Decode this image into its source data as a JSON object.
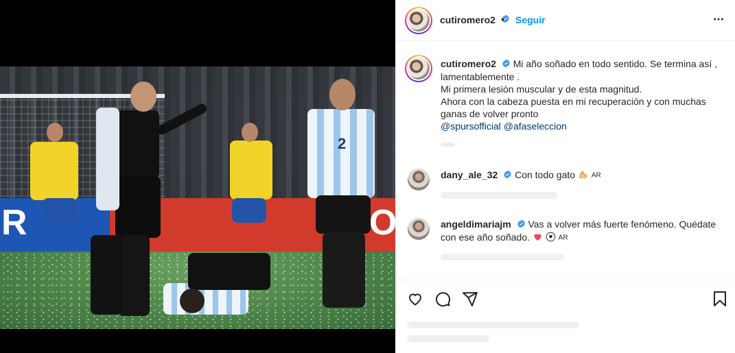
{
  "post": {
    "author": "cutiromero2",
    "verified": true,
    "follow_label": "Seguir",
    "separator": "•"
  },
  "caption": {
    "username": "cutiromero2",
    "lines": [
      "Mi año soñado en todo sentido. Se termina así ,",
      "lamentablemente .",
      "Mi primera lesión muscular y de esta magnitud.",
      "Ahora con la cabeza puesta en mi recuperación y con muchas",
      "ganas de volver pronto"
    ],
    "mentions": [
      "@spursofficial",
      "@afaseleccion"
    ]
  },
  "comments": [
    {
      "username": "dany_ale_32",
      "verified": true,
      "text": "Con todo gato",
      "emojis": [
        "flexed-biceps-icon"
      ],
      "flag_code": "AR"
    },
    {
      "username": "angeldimariajm",
      "verified": true,
      "text_line1": "Vas a volver más fuerte fenómeno. Quédate",
      "text_line2": "con ese año soñado.",
      "emojis": [
        "heart-icon",
        "soccer-ball-icon"
      ],
      "flag_code": "AR"
    }
  ],
  "photo": {
    "board_text_left": "R",
    "board_text_right": "O",
    "jersey_number": "2"
  },
  "icons": {
    "verified": "verified-badge-icon",
    "more": "more-options-icon",
    "like": "heart-icon",
    "comment": "comment-icon",
    "share": "send-icon",
    "save": "bookmark-icon"
  },
  "colors": {
    "accent": "#0095f6",
    "verified": "#3897f0",
    "link": "#00376b",
    "heart": "#ed4956"
  }
}
